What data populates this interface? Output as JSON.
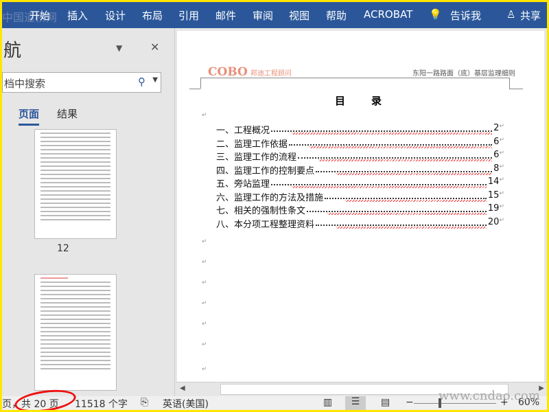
{
  "watermark": "中国道桥网",
  "ribbon": {
    "tabs": [
      "开始",
      "插入",
      "设计",
      "布局",
      "引用",
      "邮件",
      "审阅",
      "视图",
      "帮助",
      "ACROBAT"
    ],
    "tell_me": "告诉我",
    "share": "共享"
  },
  "nav": {
    "title": "航",
    "search_placeholder": "档中搜索",
    "tabs": [
      "页面",
      "结果"
    ],
    "page_number": "12"
  },
  "document": {
    "logo": "COBO",
    "logo_sub": "邦迪工程顾问",
    "header_text": "东阳一路路面（底）基层监理细则",
    "toc_title": "目录",
    "toc": [
      {
        "label": "一、工程概况",
        "page": "2"
      },
      {
        "label": "二、监理工作依据",
        "page": "6"
      },
      {
        "label": "三、监理工作的流程",
        "page": "6"
      },
      {
        "label": "四、监理工作的控制要点",
        "page": "8"
      },
      {
        "label": "五、旁站监理",
        "page": "14"
      },
      {
        "label": "六、监理工作的方法及措施",
        "page": "15"
      },
      {
        "label": "七、相关的强制性条文",
        "page": "19"
      },
      {
        "label": "八、本分项工程整理资料",
        "page": "20"
      }
    ]
  },
  "status": {
    "pages": "页，共 20 页",
    "words": "11518 个字",
    "language": "英语(美国)",
    "zoom": "60%",
    "site_watermark": "www.cndao.com"
  }
}
